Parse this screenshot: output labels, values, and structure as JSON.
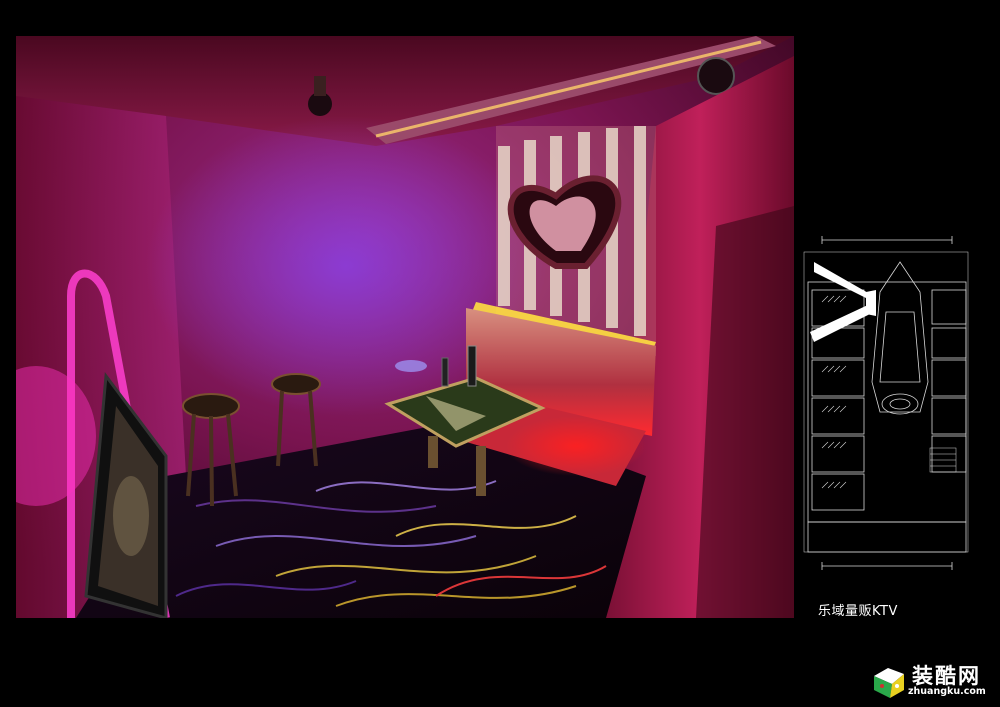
{
  "caption": "乐域量贩KTV",
  "watermark": {
    "brand": "装酷网",
    "url": "zhuangku.com"
  },
  "colors": {
    "background": "#000000",
    "room_magenta": "#c0206a",
    "purple_glow": "#7a30c8",
    "sofa_red": "#e0202a",
    "led_yellow": "#ffe040"
  }
}
